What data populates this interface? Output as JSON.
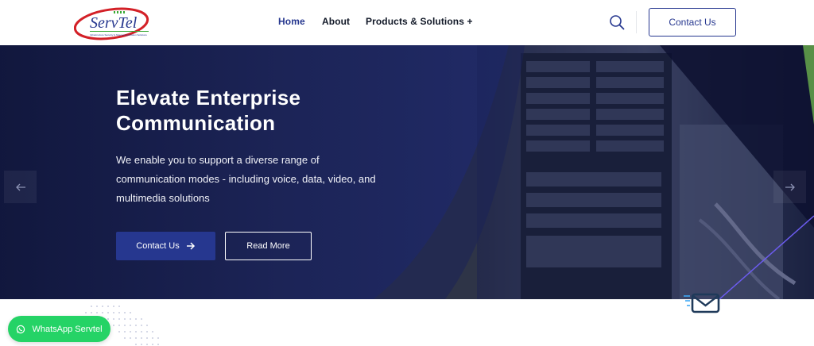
{
  "brand": {
    "logo_text": "ServTel",
    "logo_tagline": "Infrastructure Security & Telecommunication Solutions",
    "colors": {
      "primary": "#26378f",
      "logo_red": "#d32027",
      "logo_green": "#3aa935",
      "whatsapp": "#25d366"
    }
  },
  "nav": {
    "items": [
      {
        "label": "Home",
        "active": true
      },
      {
        "label": "About",
        "active": false
      },
      {
        "label": "Products & Solutions +",
        "active": false
      }
    ],
    "search_icon": "search-icon",
    "contact_label": "Contact Us"
  },
  "hero": {
    "title": "Elevate Enterprise Communication",
    "description": "We enable you to support a diverse range of communication modes - including voice, data, video, and multimedia solutions",
    "primary_button": "Contact Us",
    "secondary_button": "Read More",
    "prev_icon": "arrow-left-icon",
    "next_icon": "arrow-right-icon"
  },
  "whatsapp": {
    "label": "WhatsApp Servtel",
    "icon": "whatsapp-icon"
  },
  "decor": {
    "mail_icon": "mail-icon"
  }
}
